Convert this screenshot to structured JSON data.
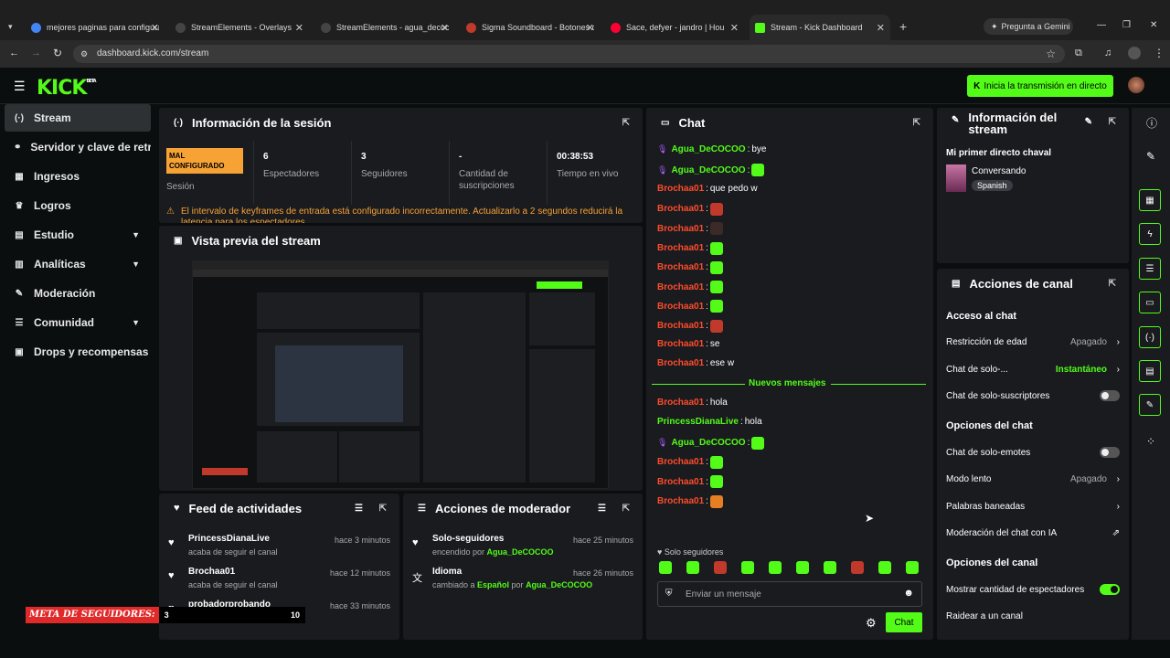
{
  "browser": {
    "tabs": [
      {
        "title": "mejores paginas para configura",
        "color": "#4285f4"
      },
      {
        "title": "StreamElements - Overlays",
        "color": "#444"
      },
      {
        "title": "StreamElements - agua_decoco",
        "color": "#444"
      },
      {
        "title": "Sigma Soundboard - Botones d",
        "color": "#c0392b"
      },
      {
        "title": "Sace, defyer - jandro | Hou",
        "color": "#ff0033"
      },
      {
        "title": "Stream - Kick Dashboard",
        "color": "#53fc18"
      }
    ],
    "gemini": "Pregunta a Gemini",
    "url": "dashboard.kick.com/stream"
  },
  "app": {
    "logo": "KICK",
    "logo_badge": "BETA",
    "go_live": "Inicia la transmisión en directo"
  },
  "sidebar": {
    "items": [
      {
        "label": "Stream",
        "icon": "(·)",
        "expand": false
      },
      {
        "label": "Servidor y clave de retransmisión",
        "icon": "⚭",
        "expand": false
      },
      {
        "label": "Ingresos",
        "icon": "▦",
        "expand": false
      },
      {
        "label": "Logros",
        "icon": "♛",
        "expand": false
      },
      {
        "label": "Estudio",
        "icon": "▤",
        "expand": true
      },
      {
        "label": "Analíticas",
        "icon": "▥",
        "expand": true
      },
      {
        "label": "Moderación",
        "icon": "✎",
        "expand": false
      },
      {
        "label": "Comunidad",
        "icon": "☰",
        "expand": true
      },
      {
        "label": "Drops y recompensas",
        "icon": "▣",
        "expand": false
      }
    ]
  },
  "session": {
    "title": "Información de la sesión",
    "status": "MAL CONFIGURADO",
    "status_label": "Sesión",
    "stats": [
      {
        "value": "6",
        "label": "Espectadores"
      },
      {
        "value": "3",
        "label": "Seguidores"
      },
      {
        "value": "-",
        "label": "Cantidad de suscripciones"
      },
      {
        "value": "00:38:53",
        "label": "Tiempo en vivo"
      }
    ],
    "warning": "El intervalo de keyframes de entrada está configurado incorrectamente. Actualizarlo a 2 segundos reducirá la latencia para los espectadores"
  },
  "preview": {
    "title": "Vista previa del stream",
    "meta_label": "META DE SEGUIDORES:",
    "meta_current": "3",
    "meta_goal": "10"
  },
  "activity": {
    "title": "Feed de actividades",
    "items": [
      {
        "user": "PrincessDianaLive",
        "action": "acaba de seguir el canal",
        "time": "hace 3 minutos"
      },
      {
        "user": "Brochaa01",
        "action": "acaba de seguir el canal",
        "time": "hace 12 minutos"
      },
      {
        "user": "probadorprobando",
        "action": "",
        "time": "hace 33 minutos"
      }
    ]
  },
  "modactions": {
    "title": "Acciones de moderador",
    "items": [
      {
        "title": "Solo-seguidores",
        "pre": "encendido por ",
        "hl": "Agua_DeCOCOO",
        "mid": "",
        "hl2": "",
        "time": "hace 25 minutos",
        "icon": "♥"
      },
      {
        "title": "Idioma",
        "pre": "cambiado a ",
        "hl": "Español",
        "mid": " por ",
        "hl2": "Agua_DeCOCOO",
        "time": "hace 26 minutos",
        "icon": "文"
      }
    ]
  },
  "chat": {
    "title": "Chat",
    "messages": [
      {
        "user": "Agua_DeCOCOO",
        "type": "mod",
        "text": "bye",
        "emote": ""
      },
      {
        "user": "Agua_DeCOCOO",
        "type": "mod",
        "text": "",
        "emote": "#53fc18"
      },
      {
        "user": "Brochaa01",
        "type": "red",
        "text": "que pedo w",
        "emote": ""
      },
      {
        "user": "Brochaa01",
        "type": "red",
        "text": "",
        "emote": "#c0392b"
      },
      {
        "user": "Brochaa01",
        "type": "red",
        "text": "",
        "emote": "#3b2a28"
      },
      {
        "user": "Brochaa01",
        "type": "red",
        "text": "",
        "emote": "#53fc18"
      },
      {
        "user": "Brochaa01",
        "type": "red",
        "text": "",
        "emote": "#53fc18"
      },
      {
        "user": "Brochaa01",
        "type": "red",
        "text": "",
        "emote": "#53fc18"
      },
      {
        "user": "Brochaa01",
        "type": "red",
        "text": "",
        "emote": "#53fc18"
      },
      {
        "user": "Brochaa01",
        "type": "red",
        "text": "",
        "emote": "#c0392b"
      },
      {
        "user": "Brochaa01",
        "type": "red",
        "text": "se",
        "emote": ""
      },
      {
        "user": "Brochaa01",
        "type": "red",
        "text": "ese w",
        "emote": ""
      }
    ],
    "new_label": "Nuevos mensajes",
    "new_messages": [
      {
        "user": "Brochaa01",
        "type": "red",
        "text": "hola",
        "emote": ""
      },
      {
        "user": "PrincessDianaLive",
        "type": "green",
        "text": "hola",
        "emote": ""
      },
      {
        "user": "Agua_DeCOCOO",
        "type": "mod",
        "text": "",
        "emote": "#53fc18"
      },
      {
        "user": "Brochaa01",
        "type": "red",
        "text": "",
        "emote": "#53fc18"
      },
      {
        "user": "Brochaa01",
        "type": "red",
        "text": "",
        "emote": "#53fc18"
      },
      {
        "user": "Brochaa01",
        "type": "red",
        "text": "",
        "emote": "#e67e22"
      }
    ],
    "mode_label": "Solo seguidores",
    "emote_colors": [
      "#53fc18",
      "#53fc18",
      "#c0392b",
      "#53fc18",
      "#53fc18",
      "#53fc18",
      "#53fc18",
      "#c0392b",
      "#53fc18",
      "#53fc18"
    ],
    "placeholder": "Enviar un mensaje",
    "send": "Chat"
  },
  "streaminfo": {
    "title": "Información del stream",
    "stream_title": "Mi primer directo chaval",
    "category": "Conversando",
    "language": "Spanish"
  },
  "channel": {
    "title": "Acciones de canal",
    "sec1": "Acceso al chat",
    "age": {
      "label": "Restricción de edad",
      "value": "Apagado"
    },
    "followers": {
      "label": "Chat de solo-...",
      "value": "Instantáneo"
    },
    "subs": {
      "label": "Chat de solo-suscriptores"
    },
    "sec2": "Opciones del chat",
    "emotes": {
      "label": "Chat de solo-emotes"
    },
    "slow": {
      "label": "Modo lento",
      "value": "Apagado"
    },
    "banned": {
      "label": "Palabras baneadas"
    },
    "aimod": {
      "label": "Moderación del chat con IA"
    },
    "sec3": "Opciones del canal",
    "viewers": {
      "label": "Mostrar cantidad de espectadores"
    },
    "raid": {
      "label": "Raidear a un canal"
    }
  }
}
